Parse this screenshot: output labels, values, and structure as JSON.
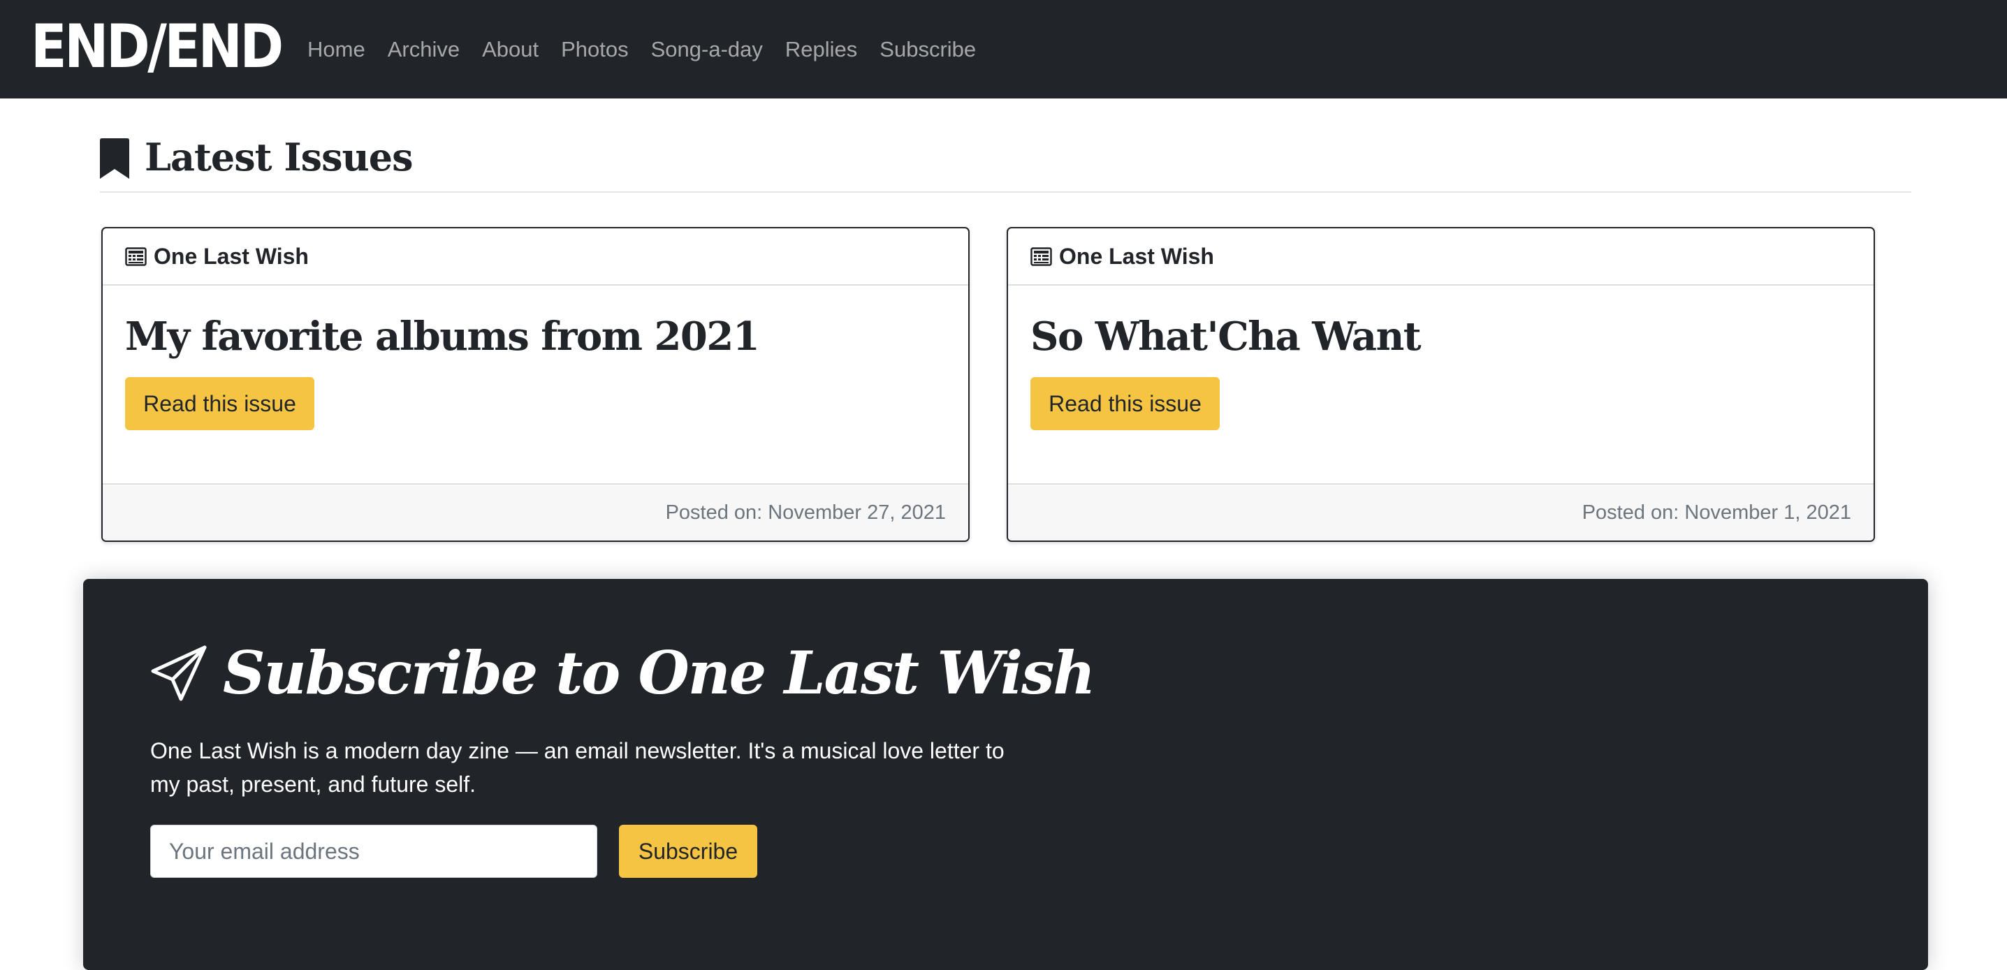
{
  "nav": {
    "brand": "END/END",
    "links": [
      "Home",
      "Archive",
      "About",
      "Photos",
      "Song-a-day",
      "Replies",
      "Subscribe"
    ]
  },
  "section": {
    "title": "Latest Issues",
    "icon": "bookmark-icon"
  },
  "cards": [
    {
      "zine": "One Last Wish",
      "title": "My favorite albums from 2021",
      "button": "Read this issue",
      "posted": "Posted on: November 27, 2021"
    },
    {
      "zine": "One Last Wish",
      "title": "So What'Cha Want",
      "button": "Read this issue",
      "posted": "Posted on: November 1, 2021"
    }
  ],
  "subscribe": {
    "title": "Subscribe to One Last Wish",
    "description": "One Last Wish is a modern day zine — an email newsletter. It's a musical love letter to my past, present, and future self.",
    "email_placeholder": "Your email address",
    "button": "Subscribe"
  },
  "colors": {
    "navbar_bg": "#212529",
    "accent_yellow": "#f5c443",
    "panel_bg": "#212529"
  }
}
